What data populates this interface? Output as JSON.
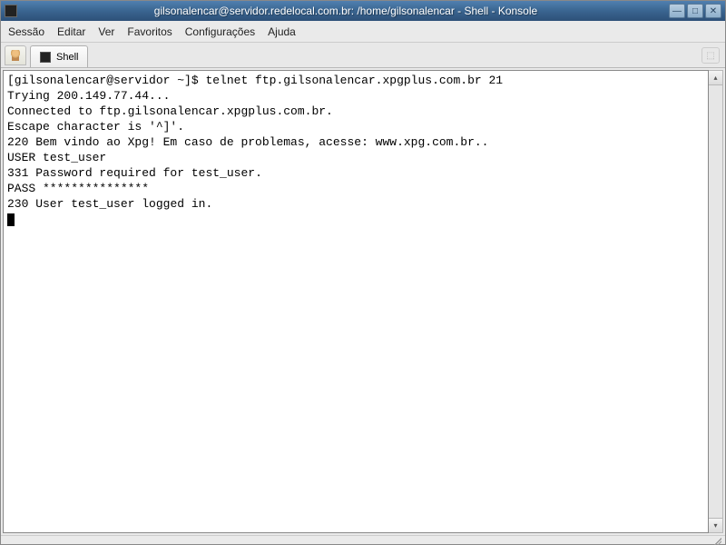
{
  "window": {
    "title": "gilsonalencar@servidor.redelocal.com.br: /home/gilsonalencar - Shell - Konsole"
  },
  "menu": {
    "session": "Sessão",
    "edit": "Editar",
    "view": "Ver",
    "favorites": "Favoritos",
    "settings": "Configurações",
    "help": "Ajuda"
  },
  "tab": {
    "label": "Shell"
  },
  "terminal": {
    "lines": {
      "l0_prompt": "[gilsonalencar@servidor ~]$ ",
      "l0_cmd": "telnet ftp.gilsonalencar.xpgplus.com.br 21",
      "l1": "Trying 200.149.77.44...",
      "l2": "Connected to ftp.gilsonalencar.xpgplus.com.br.",
      "l3": "Escape character is '^]'.",
      "l4": "220 Bem vindo ao Xpg! Em caso de problemas, acesse: www.xpg.com.br..",
      "l5a": "USER ",
      "l5b": "test_user",
      "l6a": "331 Password required for ",
      "l6b": "test_user",
      "l6c": ".",
      "l7": "PASS ***************",
      "l8a": "230 User ",
      "l8b": "test_user",
      "l8c": " logged in."
    }
  }
}
